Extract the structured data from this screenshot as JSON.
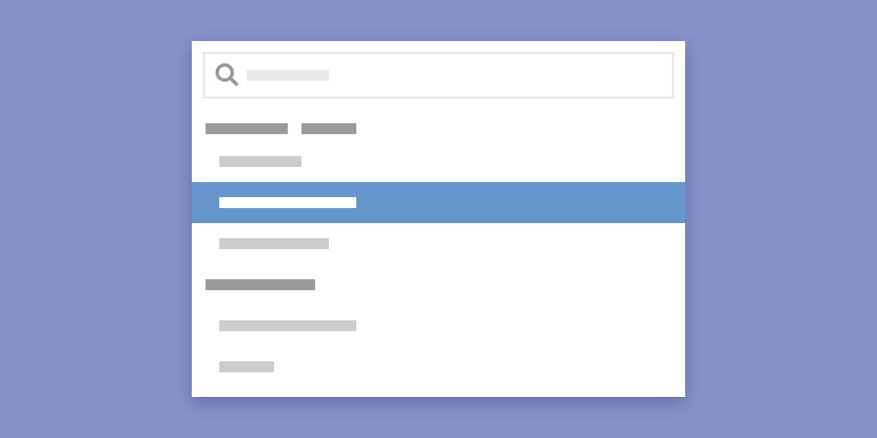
{
  "colors": {
    "background": "#8691cc",
    "panel": "#ffffff",
    "search_border": "#e7e7e7",
    "group_header_bar": "#9b9b9b",
    "item_bar": "#cdcdcd",
    "selected_row": "#6397cc",
    "selected_text_bar": "#ffffff",
    "icon": "#999999"
  },
  "search": {
    "icon": "search-icon",
    "value": ""
  },
  "groups": [
    {
      "header": "",
      "items": [
        {
          "label": "",
          "selected": false
        },
        {
          "label": "",
          "selected": true
        },
        {
          "label": "",
          "selected": false
        }
      ]
    },
    {
      "header": "",
      "items": [
        {
          "label": "",
          "selected": false
        },
        {
          "label": "",
          "selected": false
        }
      ]
    }
  ]
}
